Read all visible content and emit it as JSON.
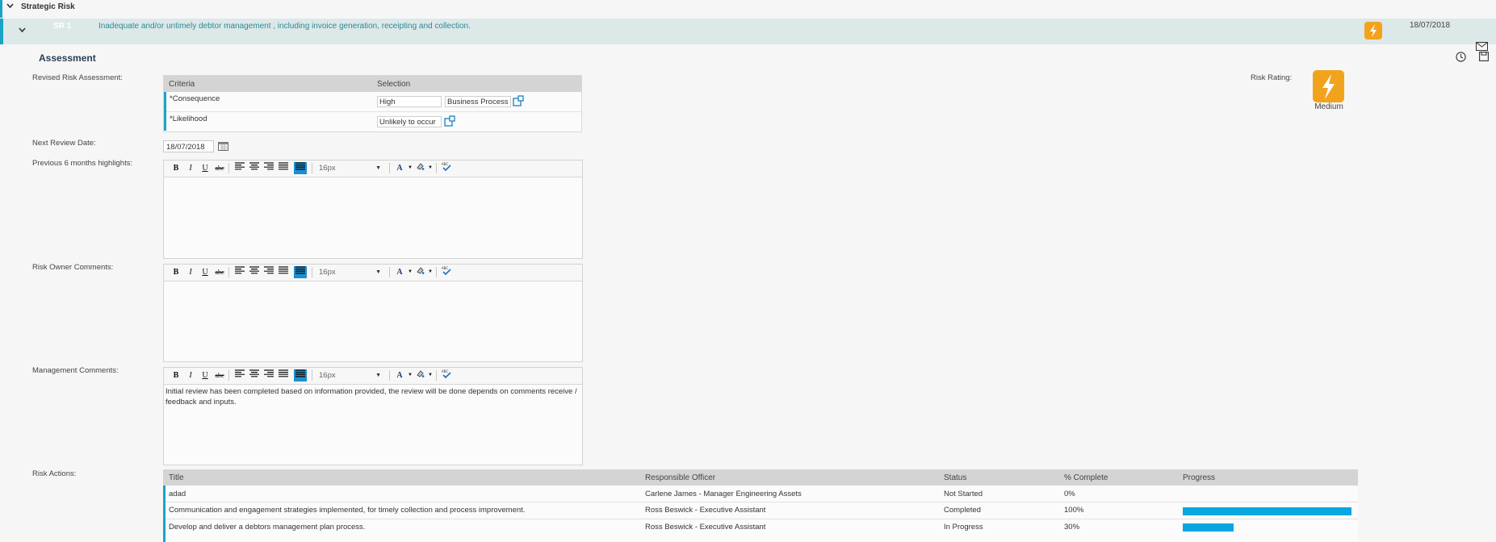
{
  "group": {
    "title": "Strategic Risk"
  },
  "risk": {
    "code": "SR 1",
    "description": "Inadequate and/or untimely debtor management , including invoice generation, receipting and collection.",
    "date": "18/07/2018"
  },
  "assessment": {
    "title": "Assessment",
    "revised_label": "Revised Risk Assessment:",
    "criteria_headers": [
      "Criteria",
      "Selection"
    ],
    "criteria": [
      {
        "required": "*",
        "name": "Consequence",
        "value": "High",
        "extra": "Business Process"
      },
      {
        "required": "*",
        "name": "Likelihood",
        "value": "Unlikely to occur"
      }
    ],
    "next_review_label": "Next Review Date:",
    "next_review_value": "18/07/2018",
    "highlights_label": "Previous 6 months highlights:",
    "owner_comments_label": "Risk Owner Comments:",
    "management_comments_label": "Management Comments:",
    "management_comments_text": "Initial review has been completed based on information provided, the review will be done depends on comments receive / feedback and inputs.",
    "font_size_value": "16px",
    "rating_label": "Risk Rating:",
    "rating_value": "Medium"
  },
  "toolbar_buttons": {
    "bold": "B",
    "italic": "I",
    "underline": "U",
    "strike": "abc",
    "font_color": "A"
  },
  "actions": {
    "label": "Risk Actions:",
    "headers": [
      "Title",
      "Responsible Officer",
      "Status",
      "% Complete",
      "Progress"
    ],
    "rows": [
      {
        "title": "adad",
        "officer": "Carlene James - Manager Engineering Assets",
        "status": "Not Started",
        "percent": "0%",
        "progress": 0
      },
      {
        "title": "Communication and engagement strategies implemented, for timely collection and process improvement.",
        "officer": "Ross Beswick - Executive Assistant",
        "status": "Completed",
        "percent": "100%",
        "progress": 100
      },
      {
        "title": "Develop and deliver a debtors management plan process.",
        "officer": "Ross Beswick - Executive Assistant",
        "status": "In Progress",
        "percent": "30%",
        "progress": 30
      }
    ]
  },
  "colors": {
    "accent": "#19a3c7",
    "rating": "#f2a31d",
    "progress": "#0aa6e0"
  },
  "icons": [
    "chevron-down-icon",
    "lightning-bolt-icon",
    "mail-icon",
    "clock-icon",
    "save-icon",
    "calendar-icon",
    "popup-icon",
    "spellcheck-icon",
    "highlight-color-icon"
  ]
}
